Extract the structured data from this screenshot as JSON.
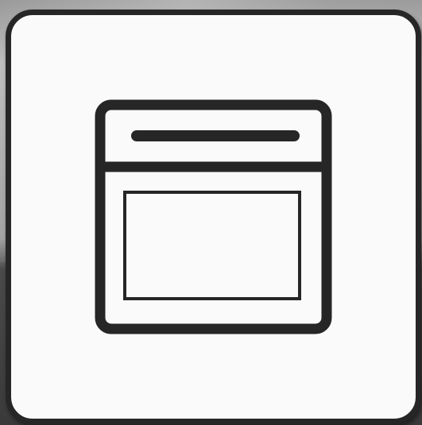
{
  "tile": {
    "icon": "oven-icon",
    "background_color": "#fafafa",
    "stroke_color": "#262626"
  }
}
